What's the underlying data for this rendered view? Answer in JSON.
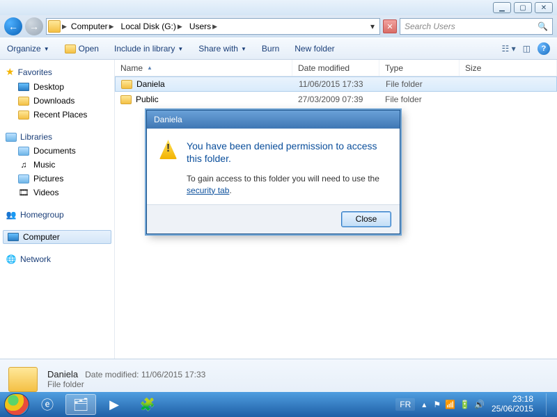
{
  "breadcrumb": {
    "root": "Computer",
    "disk": "Local Disk (G:)",
    "folder": "Users"
  },
  "search": {
    "placeholder": "Search Users"
  },
  "toolbar": {
    "organize": "Organize",
    "open": "Open",
    "include": "Include in library",
    "share": "Share with",
    "burn": "Burn",
    "newfolder": "New folder"
  },
  "columns": {
    "name": "Name",
    "date": "Date modified",
    "type": "Type",
    "size": "Size"
  },
  "rows": [
    {
      "name": "Daniela",
      "date": "11/06/2015 17:33",
      "type": "File folder",
      "selected": true
    },
    {
      "name": "Public",
      "date": "27/03/2009 07:39",
      "type": "File folder",
      "selected": false
    }
  ],
  "sidebar": {
    "favorites": "Favorites",
    "fav_items": [
      "Desktop",
      "Downloads",
      "Recent Places"
    ],
    "libraries": "Libraries",
    "lib_items": [
      "Documents",
      "Music",
      "Pictures",
      "Videos"
    ],
    "homegroup": "Homegroup",
    "computer": "Computer",
    "network": "Network"
  },
  "details": {
    "name": "Daniela",
    "date_label": "Date modified:",
    "date": "11/06/2015 17:33",
    "type": "File folder"
  },
  "dialog": {
    "title": "Daniela",
    "heading": "You have been denied permission to access this folder.",
    "body_pre": "To gain access to this folder you will need to use the ",
    "link": "security tab",
    "body_post": ".",
    "close": "Close"
  },
  "tray": {
    "lang": "FR",
    "time": "23:18",
    "date": "25/06/2015"
  }
}
